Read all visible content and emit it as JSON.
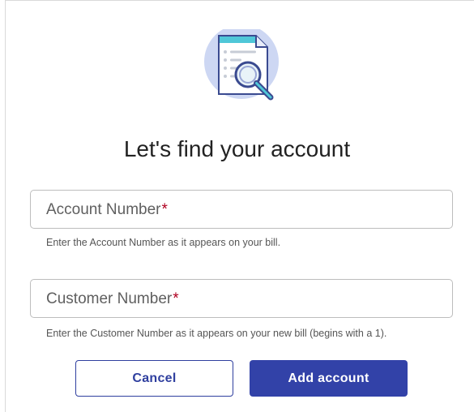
{
  "heading": "Let's find your account",
  "account_field": {
    "label": "Account Number",
    "required_mark": "*",
    "helper": "Enter the Account Number as it appears on your bill."
  },
  "customer_field": {
    "label": "Customer Number",
    "required_mark": "*",
    "helper": "Enter the Customer Number as it appears on your new bill (begins with a 1)."
  },
  "buttons": {
    "cancel": "Cancel",
    "add": "Add account"
  },
  "illustration": {
    "icon": "document-search-icon",
    "colors": {
      "circle": "#cdd7f3",
      "header_band": "#4fc7d8",
      "outline": "#3a4a90",
      "accent": "#2f3f9f"
    }
  },
  "colors": {
    "primary": "#3242a8",
    "required": "#b00020"
  }
}
